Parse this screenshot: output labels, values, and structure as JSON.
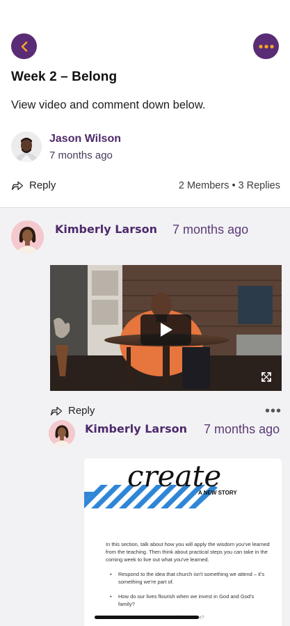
{
  "header": {
    "back_icon": "chevron-left-icon",
    "more_icon": "more-horizontal-icon",
    "accent": "#5a2c76",
    "icon_color": "#f5a623"
  },
  "post": {
    "title": "Week 2 – Belong",
    "description": "View video and comment down below.",
    "author_name": "Jason Wilson",
    "author_time": "7 months ago",
    "reply_label": "Reply",
    "stats": "2 Members • 3 Replies"
  },
  "comments": [
    {
      "name": "Kimberly Larson",
      "time": "7 months ago",
      "media": "video",
      "reply_label": "Reply",
      "more_label": "•••"
    },
    {
      "name": "Kimberly Larson",
      "time": "7 months ago",
      "media": "document",
      "doc": {
        "title": "create",
        "subtitle": "A NEW STORY",
        "paragraph": "In this section, talk about how you will apply the wisdom you've learned from the teaching. Then think about practical steps you can take in the coming week to live out what you've learned.",
        "bullets": [
          "Respond to the idea that church isn't something we attend – it's something we're part of.",
          "How do our lives flourish when we invest in God and God's family?"
        ],
        "cutoff_line": "...investment?"
      }
    }
  ]
}
